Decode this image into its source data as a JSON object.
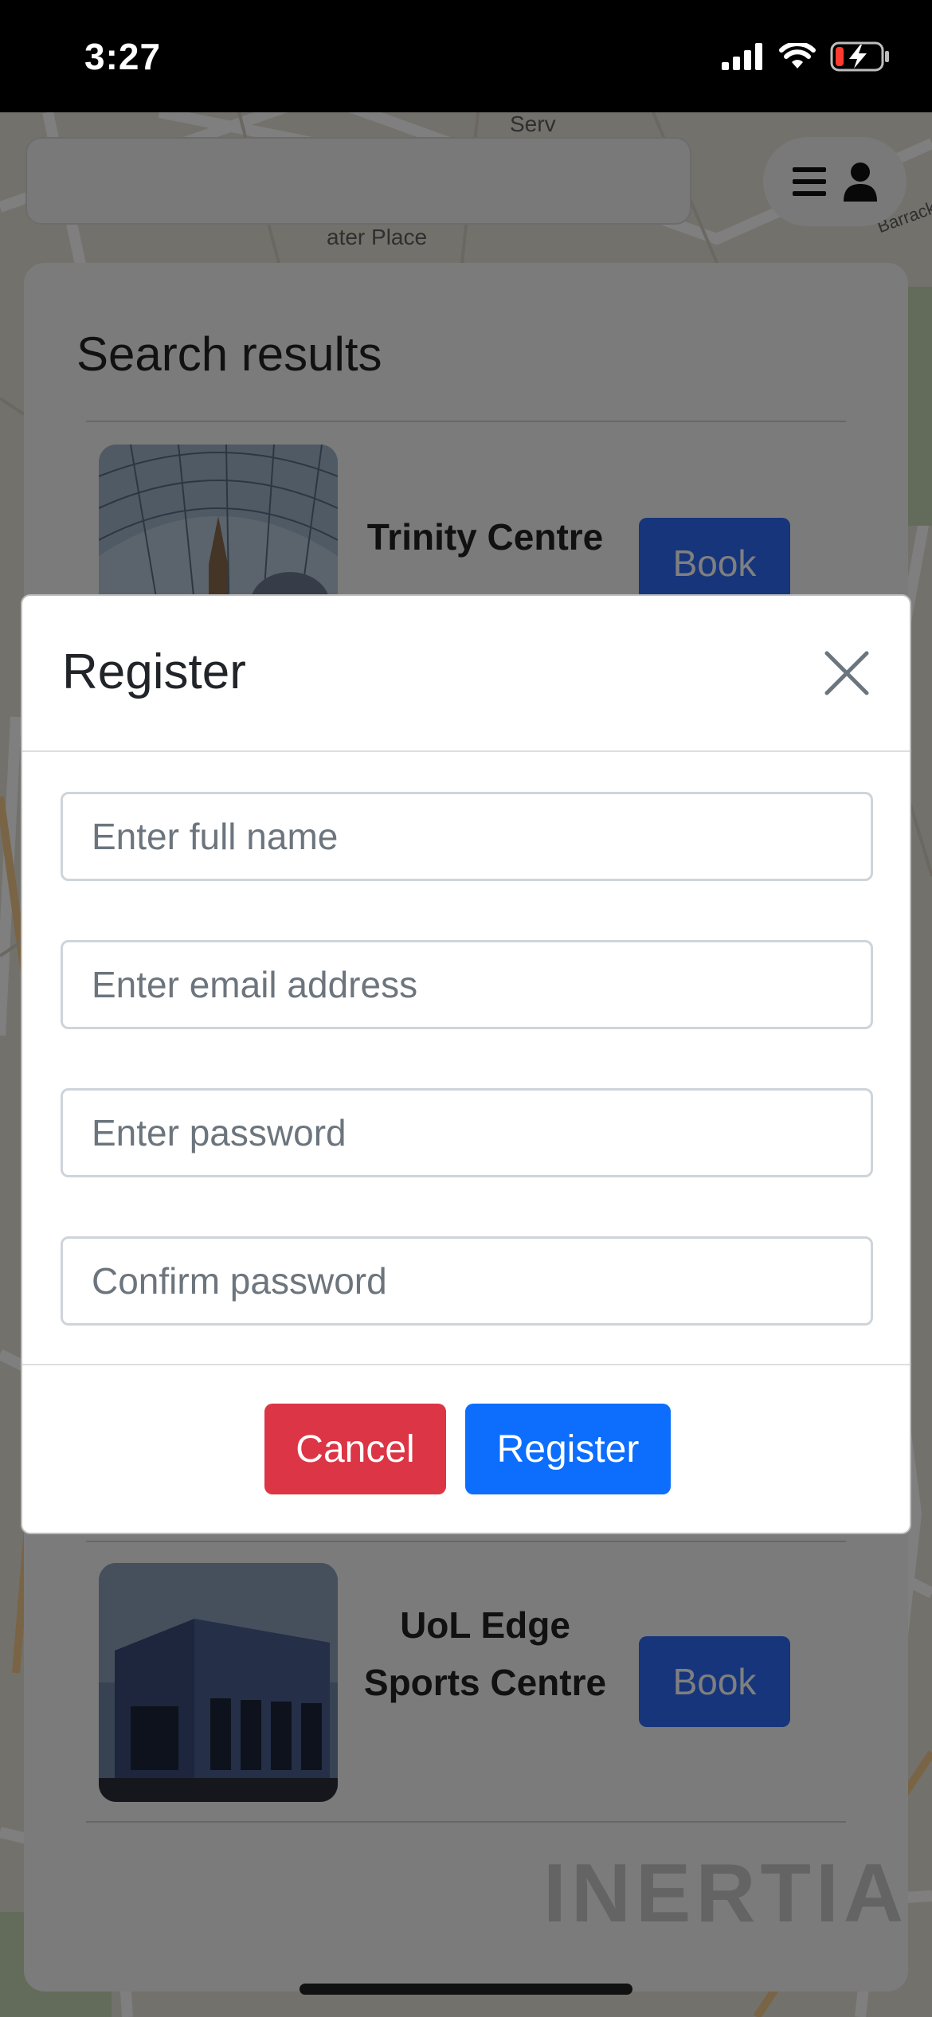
{
  "status_bar": {
    "time": "3:27"
  },
  "map_labels": [
    "Serv",
    "ater Place",
    "Barrack"
  ],
  "header": {
    "search_value": "",
    "menu_icon": "hamburger-icon",
    "user_icon": "user-icon"
  },
  "results": {
    "title": "Search results",
    "items": [
      {
        "name": "Trinity Centre",
        "button": "Book"
      },
      {
        "name": "UoL Edge Sports Centre",
        "button": "Book"
      }
    ]
  },
  "watermark": "INERTIA",
  "modal": {
    "title": "Register",
    "fields": {
      "full_name": "Enter full name",
      "email": "Enter email address",
      "password": "Enter password",
      "confirm_password": "Confirm password"
    },
    "cancel_label": "Cancel",
    "register_label": "Register"
  },
  "colors": {
    "primary": "#0d6efd",
    "danger": "#dc3545"
  }
}
